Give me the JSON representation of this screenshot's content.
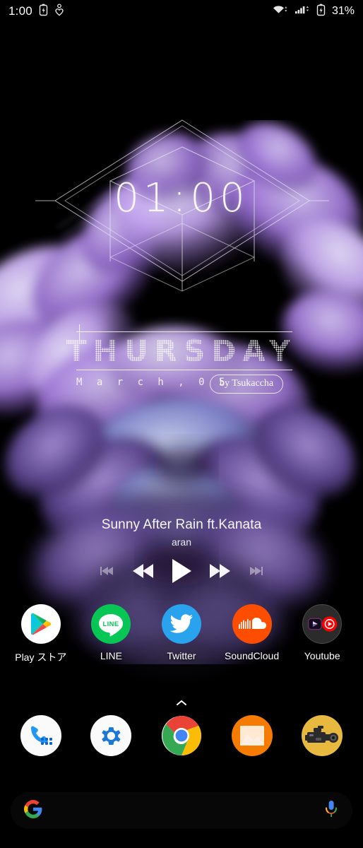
{
  "statusbar": {
    "time": "1:00",
    "battery_percent": "31%",
    "left_icons": [
      "battery-saver-icon",
      "heart-health-icon"
    ],
    "right_icons": [
      "wifi-icon",
      "cellular-signal-icon",
      "battery-charging-icon"
    ]
  },
  "clock_widget": {
    "time": "01:00",
    "decoration": "wireframe-geometry"
  },
  "date_widget": {
    "day_name": "THURSDAY",
    "date": "M a r c h ,   0 5",
    "credit": "by Tsukaccha"
  },
  "music": {
    "title": "Sunny After Rain ft.Kanata",
    "artist": "aran",
    "controls": [
      {
        "name": "previous-track-button",
        "glyph": "skip-back-icon",
        "dim": true
      },
      {
        "name": "rewind-button",
        "glyph": "rewind-icon",
        "dim": false
      },
      {
        "name": "play-button",
        "glyph": "play-icon",
        "dim": false
      },
      {
        "name": "fast-forward-button",
        "glyph": "fast-forward-icon",
        "dim": false
      },
      {
        "name": "next-track-button",
        "glyph": "skip-forward-icon",
        "dim": true
      }
    ]
  },
  "apps": [
    {
      "label": "Play ストア",
      "icon": "play-store-icon"
    },
    {
      "label": "LINE",
      "icon": "line-icon"
    },
    {
      "label": "Twitter",
      "icon": "twitter-icon"
    },
    {
      "label": "SoundCloud",
      "icon": "soundcloud-icon"
    },
    {
      "label": "Youtube",
      "icon": "youtube-folder-icon"
    }
  ],
  "page_indicator": {
    "glyph": "chevron-up-icon"
  },
  "dock": [
    {
      "label": "Phone",
      "icon": "phone-dialer-icon"
    },
    {
      "label": "Settings",
      "icon": "gear-icon"
    },
    {
      "label": "Chrome",
      "icon": "chrome-icon"
    },
    {
      "label": "Gallery",
      "icon": "gallery-photo-icon"
    },
    {
      "label": "Camera",
      "icon": "camcorder-icon"
    }
  ],
  "search": {
    "placeholder": "",
    "value": "",
    "left_icon": "google-g-icon",
    "right_icon": "microphone-icon"
  },
  "colors": {
    "background": "#000000",
    "wallpaper_purple": "#a978d8",
    "wallpaper_deep": "#3b2a63",
    "accent_white": "#ffffff",
    "soundcloud_orange": "#ff5500",
    "line_green": "#06c755",
    "twitter_blue": "#1da1f2",
    "gallery_orange": "#f57c00",
    "camera_gold": "#e8b93c",
    "searchbar_bg": "#070707"
  }
}
